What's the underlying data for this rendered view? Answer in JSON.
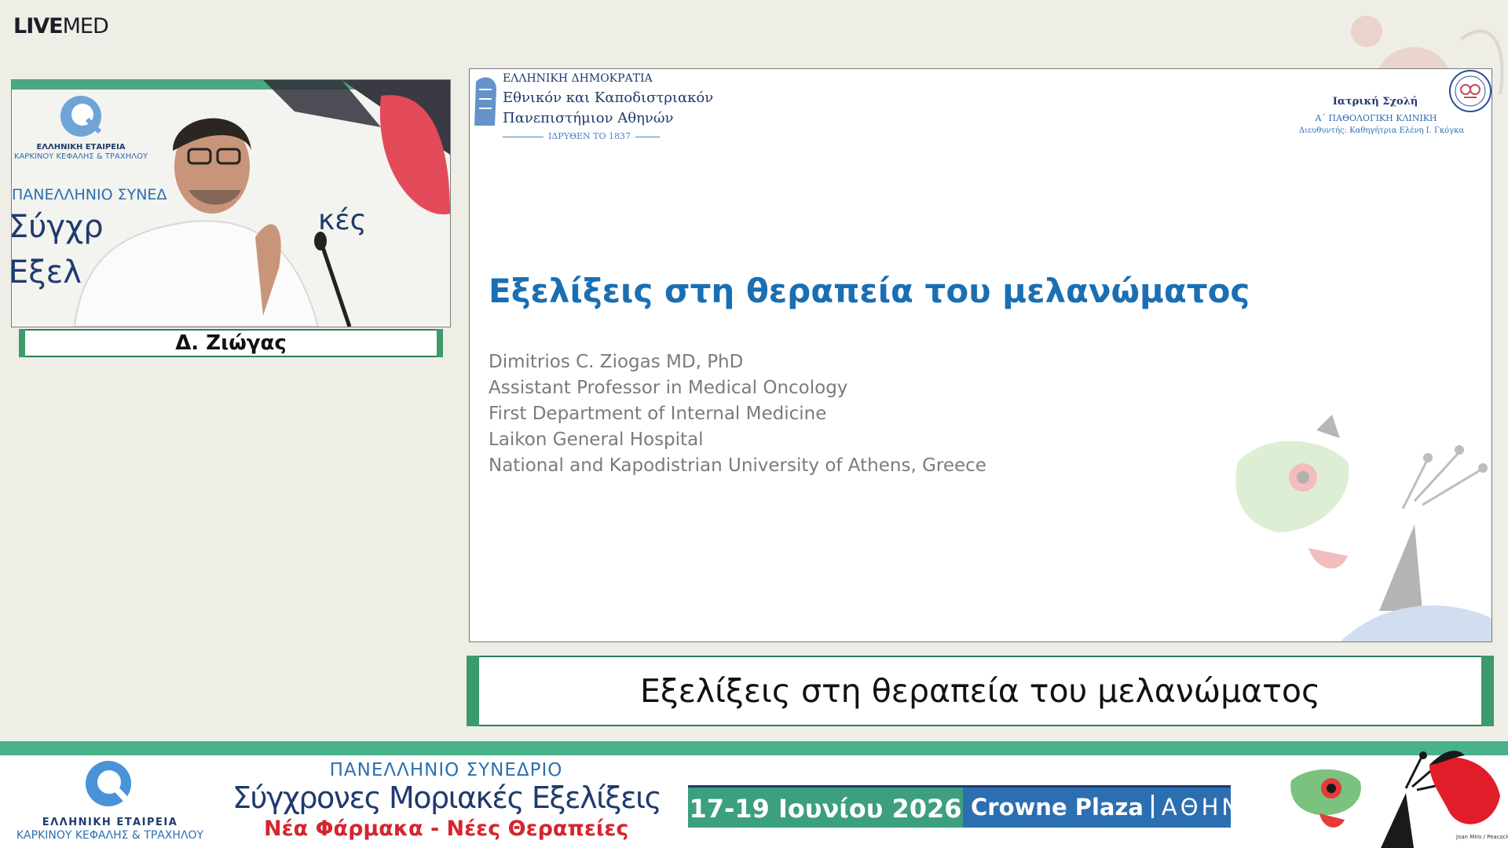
{
  "brand": {
    "part1": "LIVE",
    "part2": "MED"
  },
  "speaker": {
    "name": "Δ. Ζιώγας",
    "backdrop": {
      "society_line1": "ΕΛΛΗΝΙΚΗ ΕΤΑΙΡΕΙΑ",
      "society_line2": "ΚΑΡΚΙΝΟΥ ΚΕΦΑΛΗΣ & ΤΡΑΧΗΛΟΥ",
      "banner_line1": "ΠΑΝΕΛΛΗΝΙΟ ΣΥΝΕΔ",
      "banner_line2": "Σύγχρ",
      "banner_line2b": "κές",
      "banner_line3": "Εξελ"
    }
  },
  "slide": {
    "header_left": {
      "line1": "ΕΛΛΗΝΙΚΗ ΔΗΜΟΚΡΑΤΙΑ",
      "line2": "Εθνικόν και Καποδιστριακόν",
      "line3": "Πανεπιστήμιον Αθηνών",
      "line4": "ΙΔΡΥΘΕΝ ΤΟ 1837"
    },
    "header_right": {
      "line1": "Ιατρική Σχολή",
      "line2": "Α΄ ΠΑΘΟΛΟΓΙΚΗ ΚΛΙΝΙΚΗ",
      "line3": "Διευθυντής: Καθηγήτρια Ελένη Ι. Γκόγκα"
    },
    "title": "Εξελίξεις στη θεραπεία του μελανώματος",
    "author": [
      "Dimitrios C. Ziogas MD, PhD",
      "Assistant Professor in Medical Oncology",
      "First Department of Internal Medicine",
      "Laikon General Hospital",
      "National and Kapodistrian University of Athens, Greece"
    ]
  },
  "caption": {
    "text": "Εξελίξεις στη θεραπεία του μελανώματος"
  },
  "footer": {
    "society_line1": "ΕΛΛΗΝΙΚΗ ΕΤΑΙΡΕΙΑ",
    "society_line2": "ΚΑΡΚΙΝΟΥ ΚΕΦΑΛΗΣ & ΤΡΑΧΗΛΟΥ",
    "conf_top": "ΠΑΝΕΛΛΗΝΙΟ ΣΥΝΕΔΡΙΟ",
    "conf_main": "Σύγχρονες Μοριακές Εξελίξεις",
    "conf_sub": "Νέα Φάρμακα - Νέες Θεραπείες",
    "dates": "17-19 Ιουνίου 2026",
    "venue": "Crowne Plaza",
    "city": "ΑΘΗΝΑ",
    "artwork_credit": "Joan Miro / Peacock Feathers"
  },
  "colors": {
    "accent_green": "#3c9a6c",
    "title_blue": "#1a6fb3",
    "footer_red": "#d4262f",
    "navy": "#1f3a6d"
  }
}
